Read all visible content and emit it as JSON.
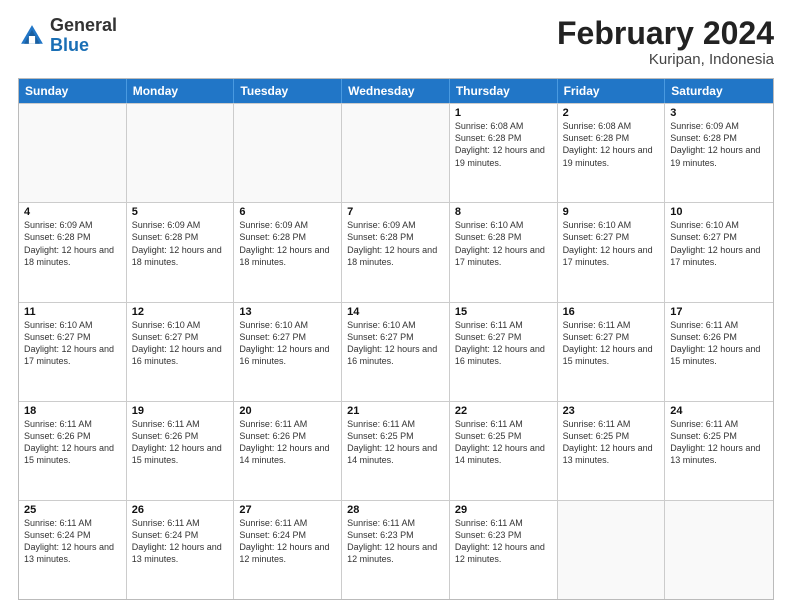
{
  "header": {
    "logo": {
      "general": "General",
      "blue": "Blue"
    },
    "title": "February 2024",
    "location": "Kuripan, Indonesia"
  },
  "days_of_week": [
    "Sunday",
    "Monday",
    "Tuesday",
    "Wednesday",
    "Thursday",
    "Friday",
    "Saturday"
  ],
  "weeks": [
    [
      {
        "day": "",
        "info": ""
      },
      {
        "day": "",
        "info": ""
      },
      {
        "day": "",
        "info": ""
      },
      {
        "day": "",
        "info": ""
      },
      {
        "day": "1",
        "info": "Sunrise: 6:08 AM\nSunset: 6:28 PM\nDaylight: 12 hours and 19 minutes."
      },
      {
        "day": "2",
        "info": "Sunrise: 6:08 AM\nSunset: 6:28 PM\nDaylight: 12 hours and 19 minutes."
      },
      {
        "day": "3",
        "info": "Sunrise: 6:09 AM\nSunset: 6:28 PM\nDaylight: 12 hours and 19 minutes."
      }
    ],
    [
      {
        "day": "4",
        "info": "Sunrise: 6:09 AM\nSunset: 6:28 PM\nDaylight: 12 hours and 18 minutes."
      },
      {
        "day": "5",
        "info": "Sunrise: 6:09 AM\nSunset: 6:28 PM\nDaylight: 12 hours and 18 minutes."
      },
      {
        "day": "6",
        "info": "Sunrise: 6:09 AM\nSunset: 6:28 PM\nDaylight: 12 hours and 18 minutes."
      },
      {
        "day": "7",
        "info": "Sunrise: 6:09 AM\nSunset: 6:28 PM\nDaylight: 12 hours and 18 minutes."
      },
      {
        "day": "8",
        "info": "Sunrise: 6:10 AM\nSunset: 6:28 PM\nDaylight: 12 hours and 17 minutes."
      },
      {
        "day": "9",
        "info": "Sunrise: 6:10 AM\nSunset: 6:27 PM\nDaylight: 12 hours and 17 minutes."
      },
      {
        "day": "10",
        "info": "Sunrise: 6:10 AM\nSunset: 6:27 PM\nDaylight: 12 hours and 17 minutes."
      }
    ],
    [
      {
        "day": "11",
        "info": "Sunrise: 6:10 AM\nSunset: 6:27 PM\nDaylight: 12 hours and 17 minutes."
      },
      {
        "day": "12",
        "info": "Sunrise: 6:10 AM\nSunset: 6:27 PM\nDaylight: 12 hours and 16 minutes."
      },
      {
        "day": "13",
        "info": "Sunrise: 6:10 AM\nSunset: 6:27 PM\nDaylight: 12 hours and 16 minutes."
      },
      {
        "day": "14",
        "info": "Sunrise: 6:10 AM\nSunset: 6:27 PM\nDaylight: 12 hours and 16 minutes."
      },
      {
        "day": "15",
        "info": "Sunrise: 6:11 AM\nSunset: 6:27 PM\nDaylight: 12 hours and 16 minutes."
      },
      {
        "day": "16",
        "info": "Sunrise: 6:11 AM\nSunset: 6:27 PM\nDaylight: 12 hours and 15 minutes."
      },
      {
        "day": "17",
        "info": "Sunrise: 6:11 AM\nSunset: 6:26 PM\nDaylight: 12 hours and 15 minutes."
      }
    ],
    [
      {
        "day": "18",
        "info": "Sunrise: 6:11 AM\nSunset: 6:26 PM\nDaylight: 12 hours and 15 minutes."
      },
      {
        "day": "19",
        "info": "Sunrise: 6:11 AM\nSunset: 6:26 PM\nDaylight: 12 hours and 15 minutes."
      },
      {
        "day": "20",
        "info": "Sunrise: 6:11 AM\nSunset: 6:26 PM\nDaylight: 12 hours and 14 minutes."
      },
      {
        "day": "21",
        "info": "Sunrise: 6:11 AM\nSunset: 6:25 PM\nDaylight: 12 hours and 14 minutes."
      },
      {
        "day": "22",
        "info": "Sunrise: 6:11 AM\nSunset: 6:25 PM\nDaylight: 12 hours and 14 minutes."
      },
      {
        "day": "23",
        "info": "Sunrise: 6:11 AM\nSunset: 6:25 PM\nDaylight: 12 hours and 13 minutes."
      },
      {
        "day": "24",
        "info": "Sunrise: 6:11 AM\nSunset: 6:25 PM\nDaylight: 12 hours and 13 minutes."
      }
    ],
    [
      {
        "day": "25",
        "info": "Sunrise: 6:11 AM\nSunset: 6:24 PM\nDaylight: 12 hours and 13 minutes."
      },
      {
        "day": "26",
        "info": "Sunrise: 6:11 AM\nSunset: 6:24 PM\nDaylight: 12 hours and 13 minutes."
      },
      {
        "day": "27",
        "info": "Sunrise: 6:11 AM\nSunset: 6:24 PM\nDaylight: 12 hours and 12 minutes."
      },
      {
        "day": "28",
        "info": "Sunrise: 6:11 AM\nSunset: 6:23 PM\nDaylight: 12 hours and 12 minutes."
      },
      {
        "day": "29",
        "info": "Sunrise: 6:11 AM\nSunset: 6:23 PM\nDaylight: 12 hours and 12 minutes."
      },
      {
        "day": "",
        "info": ""
      },
      {
        "day": "",
        "info": ""
      }
    ]
  ]
}
